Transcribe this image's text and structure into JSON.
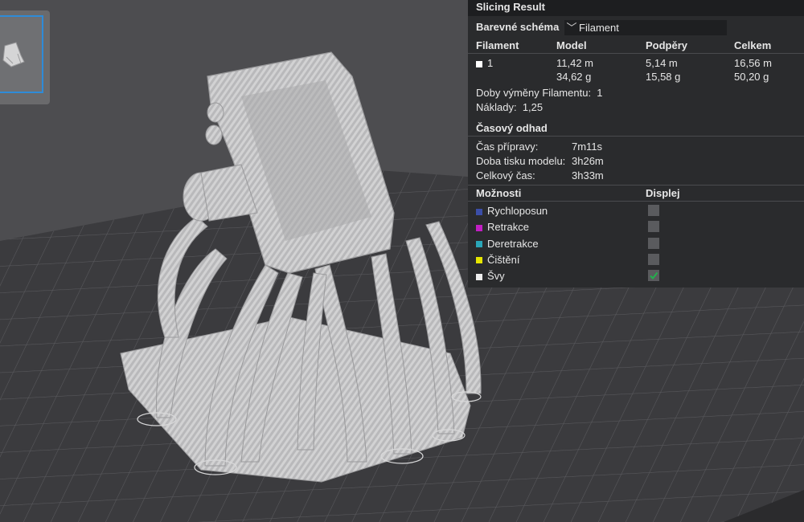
{
  "panel": {
    "title": "Slicing Result",
    "color_scheme_label": "Barevné schéma",
    "color_scheme_value": "Filament",
    "table_headers": [
      "Filament",
      "Model",
      "Podpěry",
      "Celkem"
    ],
    "filament_row": {
      "id": "1",
      "model_length": "11,42 m",
      "model_weight": "34,62 g",
      "support_length": "5,14 m",
      "support_weight": "15,58 g",
      "total_length": "16,56 m",
      "total_weight": "50,20 g"
    },
    "filament_changes_label": "Doby výměny Filamentu:",
    "filament_changes_value": "1",
    "cost_label": "Náklady:",
    "cost_value": "1,25",
    "time_estimate_header": "Časový odhad",
    "prep_time_label": "Čas přípravy:",
    "prep_time_value": "7m11s",
    "model_print_label": "Doba tisku modelu:",
    "model_print_value": "3h26m",
    "total_time_label": "Celkový čas:",
    "total_time_value": "3h33m",
    "options_header": "Možnosti",
    "display_header": "Displej",
    "options": [
      {
        "label": "Rychloposun",
        "color": "#3b4ea8",
        "checked": false
      },
      {
        "label": "Retrakce",
        "color": "#c21fc4",
        "checked": false
      },
      {
        "label": "Deretrakce",
        "color": "#2aa6b8",
        "checked": false
      },
      {
        "label": "Čištění",
        "color": "#e6e600",
        "checked": false
      },
      {
        "label": "Švy",
        "color": "#eeeeee",
        "checked": true
      }
    ]
  },
  "colors": {
    "accent": "#2e8bd8",
    "check": "#22b04c",
    "panel_bg": "#2a2b2d"
  }
}
